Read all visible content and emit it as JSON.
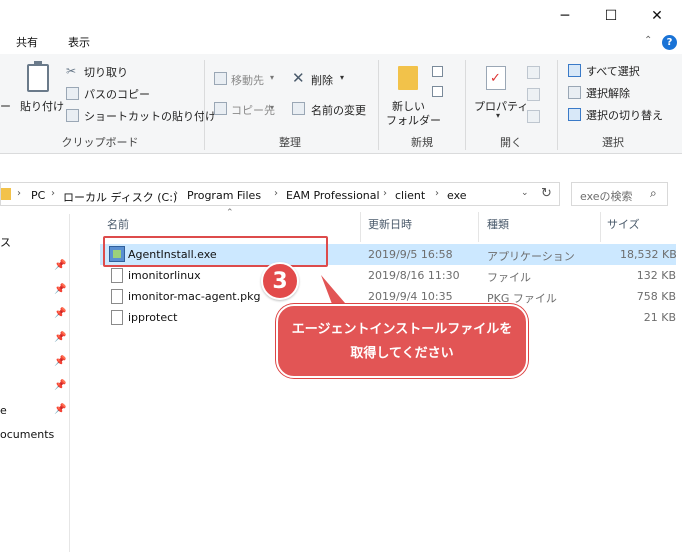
{
  "window": {
    "minimize": "─",
    "maximize": "☐",
    "close": "✕"
  },
  "ribbon_tabs": {
    "share": "共有",
    "view": "表示",
    "help": "?"
  },
  "clipboard": {
    "partial_left": "ー",
    "paste": "貼り付け",
    "cut": "切り取り",
    "copy_path": "パスのコピー",
    "paste_shortcut": "ショートカットの貼り付け",
    "label": "クリップボード"
  },
  "organize": {
    "move_to": "移動先",
    "copy_to": "コピー先",
    "delete": "削除",
    "rename": "名前の変更",
    "label": "整理"
  },
  "new_group": {
    "new_folder_line1": "新しい",
    "new_folder_line2": "フォルダー",
    "label": "新規"
  },
  "open_group": {
    "properties": "プロパティ",
    "label": "開く"
  },
  "select_group": {
    "select_all": "すべて選択",
    "select_none": "選択解除",
    "invert": "選択の切り替え",
    "label": "選択"
  },
  "address": {
    "crumbs": [
      "PC",
      "ローカル ディスク (C:)",
      "Program Files",
      "EAM Professional",
      "client",
      "exe"
    ],
    "search_placeholder": "exeの検索"
  },
  "nav": {
    "items": [
      "ス",
      "e",
      "ocuments"
    ]
  },
  "columns": {
    "name": "名前",
    "modified": "更新日時",
    "type": "種類",
    "size": "サイズ"
  },
  "files": [
    {
      "name": "AgentInstall.exe",
      "modified": "2019/9/5 16:58",
      "type": "アプリケーション",
      "size": "18,532 KB"
    },
    {
      "name": "imonitorlinux",
      "modified": "2019/8/16 11:30",
      "type": "ファイル",
      "size": "132 KB"
    },
    {
      "name": "imonitor-mac-agent.pkg",
      "modified": "2019/9/4 10:35",
      "type": "PKG ファイル",
      "size": "758 KB"
    },
    {
      "name": "ipprotect",
      "modified": "",
      "type": "",
      "size": "21 KB"
    }
  ],
  "annotation": {
    "step": "3",
    "line1": "エージェントインストールファイルを",
    "line2": "取得してください"
  },
  "colors": {
    "accent": "#e25555",
    "selection": "#cce8ff",
    "help": "#1a73d6"
  }
}
